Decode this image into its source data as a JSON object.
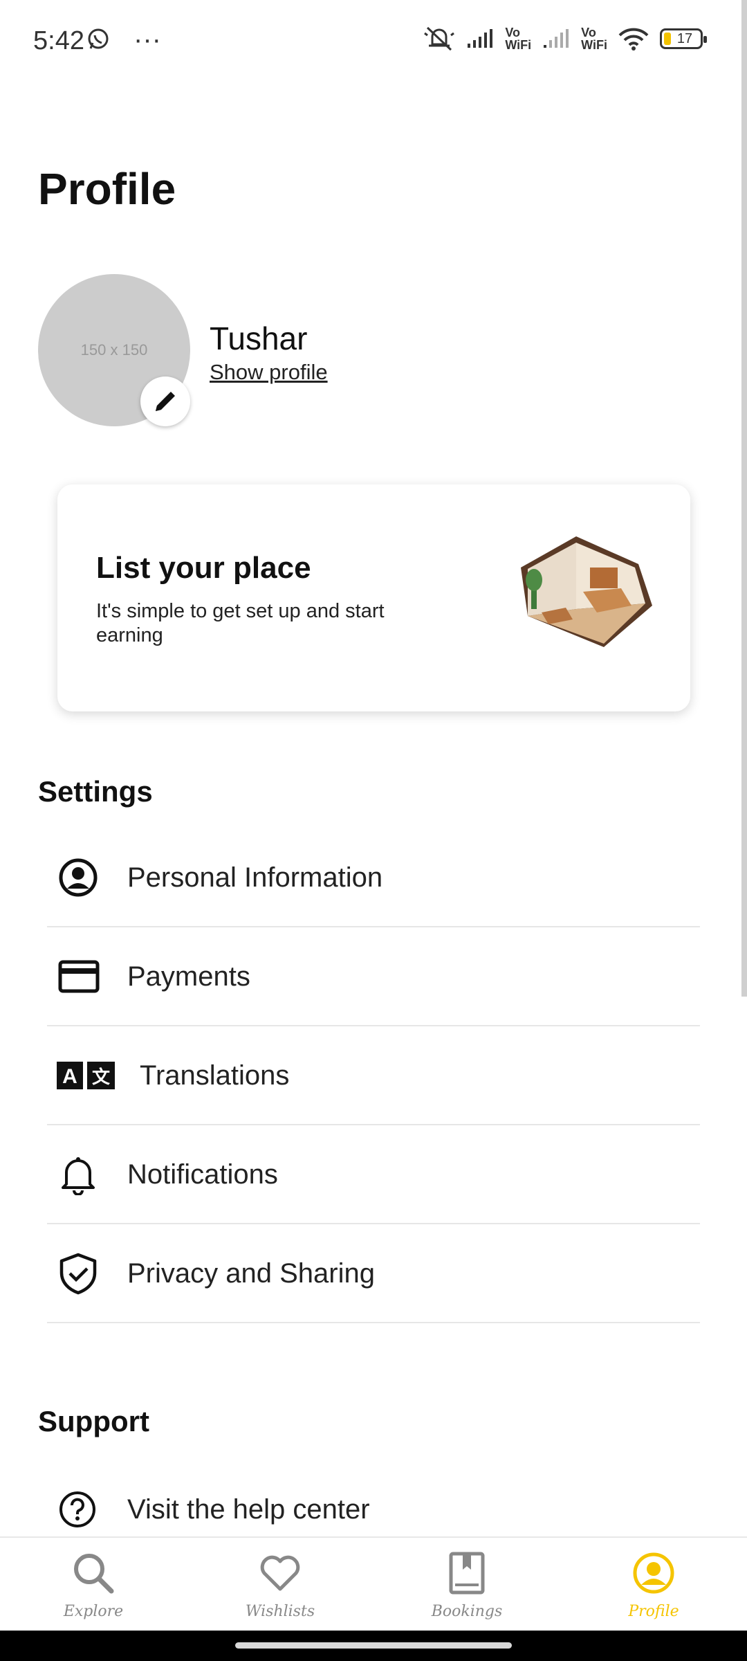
{
  "status_bar": {
    "time": "5:42",
    "dots": "···",
    "vowifi_1": "Vo\nWiFi",
    "vowifi_2": "Vo\nWiFi",
    "battery": "17"
  },
  "page": {
    "title": "Profile"
  },
  "profile": {
    "avatar_placeholder": "150 x 150",
    "name": "Tushar",
    "show_profile": "Show profile"
  },
  "list_card": {
    "title": "List your place",
    "subtitle": "It's simple to get set up and start earning"
  },
  "settings": {
    "title": "Settings",
    "items": [
      {
        "label": "Personal Information",
        "icon": "account-circle-icon"
      },
      {
        "label": "Payments",
        "icon": "credit-card-icon"
      },
      {
        "label": "Translations",
        "icon": "translate-icon"
      },
      {
        "label": "Notifications",
        "icon": "bell-icon"
      },
      {
        "label": "Privacy and Sharing",
        "icon": "shield-check-icon"
      }
    ]
  },
  "support": {
    "title": "Support",
    "items": [
      {
        "label": "Visit the help center",
        "icon": "help-circle-icon"
      }
    ]
  },
  "bottom_nav": {
    "items": [
      {
        "label": "Explore",
        "icon": "search-icon",
        "active": false
      },
      {
        "label": "Wishlists",
        "icon": "heart-icon",
        "active": false
      },
      {
        "label": "Bookings",
        "icon": "book-icon",
        "active": false
      },
      {
        "label": "Profile",
        "icon": "profile-icon",
        "active": true
      }
    ],
    "active_color": "#f5c400",
    "inactive_color": "#888888"
  }
}
